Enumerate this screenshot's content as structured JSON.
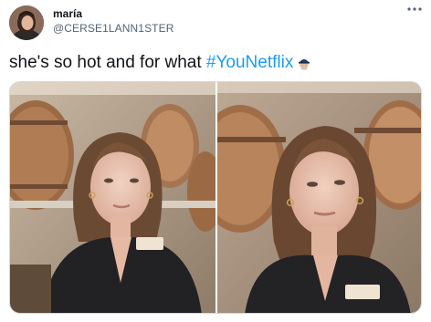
{
  "tweet": {
    "author": {
      "display_name": "maría",
      "handle": "@CERSE1LANN1STER"
    },
    "more_icon": "ellipsis-icon",
    "text_prefix": "she's so hot and for what ",
    "hashtag": "#YouNetflix",
    "hashtag_emoji": "hashtag-emoji-icon",
    "media": {
      "count": 2,
      "photos": [
        {
          "name": "photo-left"
        },
        {
          "name": "photo-right"
        }
      ]
    }
  },
  "colors": {
    "link": "#1d9bf0",
    "secondary_text": "#536471",
    "primary_text": "#0f1419",
    "border": "#cfd9de"
  }
}
